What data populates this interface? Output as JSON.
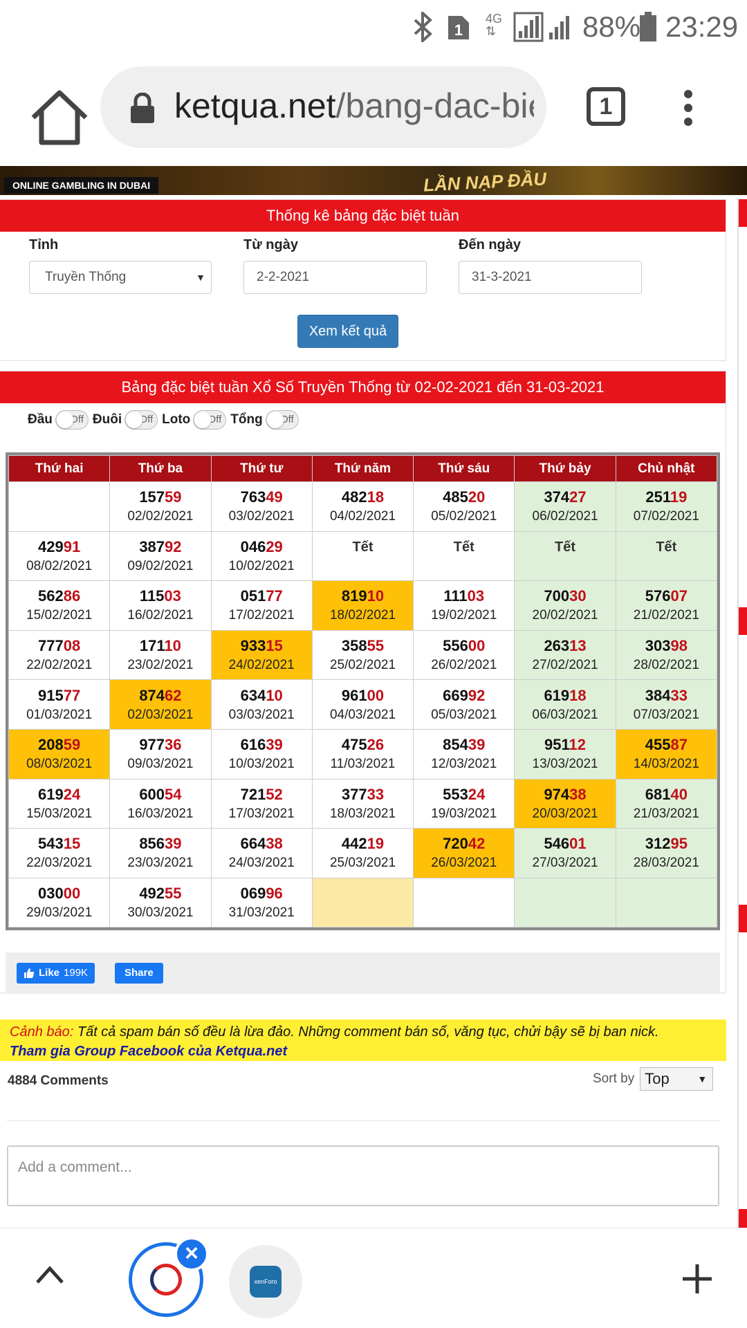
{
  "status_bar": {
    "battery": "88%",
    "time": "23:29",
    "network": "4G",
    "sim_badge": "1"
  },
  "browser": {
    "url_domain": "ketqua.net",
    "url_path": "/bang-dac-biet-tuan.html",
    "tab_count": "1"
  },
  "banner": {
    "left_text": "ONLINE GAMBLING IN DUBAI",
    "right_text": "LẦN NẠP ĐẦU"
  },
  "search_panel": {
    "title": "Thống kê bảng đặc biệt tuần",
    "province_label": "Tỉnh",
    "province_value": "Truyền Thống",
    "from_label": "Từ ngày",
    "from_value": "2-2-2021",
    "to_label": "Đến ngày",
    "to_value": "31-3-2021",
    "submit_label": "Xem kết quả"
  },
  "result_panel": {
    "title": "Bảng đặc biệt tuần Xổ Số Truyền Thống từ 02-02-2021 đến 31-03-2021",
    "toggles": [
      {
        "label": "Đầu",
        "state": "Off"
      },
      {
        "label": "Đuôi",
        "state": "Off"
      },
      {
        "label": "Loto",
        "state": "Off"
      },
      {
        "label": "Tổng",
        "state": "Off"
      }
    ]
  },
  "table": {
    "headers": [
      "Thứ hai",
      "Thứ ba",
      "Thứ tư",
      "Thứ năm",
      "Thứ sáu",
      "Thứ bảy",
      "Chủ nhật"
    ],
    "rows": [
      [
        {
          "empty": true
        },
        {
          "h": "157",
          "t": "59",
          "d": "02/02/2021"
        },
        {
          "h": "763",
          "t": "49",
          "d": "03/02/2021"
        },
        {
          "h": "482",
          "t": "18",
          "d": "04/02/2021"
        },
        {
          "h": "485",
          "t": "20",
          "d": "05/02/2021"
        },
        {
          "h": "374",
          "t": "27",
          "d": "06/02/2021"
        },
        {
          "h": "251",
          "t": "19",
          "d": "07/02/2021"
        }
      ],
      [
        {
          "h": "429",
          "t": "91",
          "d": "08/02/2021"
        },
        {
          "h": "387",
          "t": "92",
          "d": "09/02/2021"
        },
        {
          "h": "046",
          "t": "29",
          "d": "10/02/2021"
        },
        {
          "tet": "Tết"
        },
        {
          "tet": "Tết"
        },
        {
          "tet": "Tết"
        },
        {
          "tet": "Tết"
        }
      ],
      [
        {
          "h": "562",
          "t": "86",
          "d": "15/02/2021"
        },
        {
          "h": "115",
          "t": "03",
          "d": "16/02/2021"
        },
        {
          "h": "051",
          "t": "77",
          "d": "17/02/2021"
        },
        {
          "h": "819",
          "t": "10",
          "d": "18/02/2021",
          "hl": true
        },
        {
          "h": "111",
          "t": "03",
          "d": "19/02/2021"
        },
        {
          "h": "700",
          "t": "30",
          "d": "20/02/2021"
        },
        {
          "h": "576",
          "t": "07",
          "d": "21/02/2021"
        }
      ],
      [
        {
          "h": "777",
          "t": "08",
          "d": "22/02/2021"
        },
        {
          "h": "171",
          "t": "10",
          "d": "23/02/2021"
        },
        {
          "h": "933",
          "t": "15",
          "d": "24/02/2021",
          "hl": true
        },
        {
          "h": "358",
          "t": "55",
          "d": "25/02/2021"
        },
        {
          "h": "556",
          "t": "00",
          "d": "26/02/2021"
        },
        {
          "h": "263",
          "t": "13",
          "d": "27/02/2021"
        },
        {
          "h": "303",
          "t": "98",
          "d": "28/02/2021"
        }
      ],
      [
        {
          "h": "915",
          "t": "77",
          "d": "01/03/2021"
        },
        {
          "h": "874",
          "t": "62",
          "d": "02/03/2021",
          "hl": true
        },
        {
          "h": "634",
          "t": "10",
          "d": "03/03/2021"
        },
        {
          "h": "961",
          "t": "00",
          "d": "04/03/2021"
        },
        {
          "h": "669",
          "t": "92",
          "d": "05/03/2021"
        },
        {
          "h": "619",
          "t": "18",
          "d": "06/03/2021"
        },
        {
          "h": "384",
          "t": "33",
          "d": "07/03/2021"
        }
      ],
      [
        {
          "h": "208",
          "t": "59",
          "d": "08/03/2021",
          "hl": true
        },
        {
          "h": "977",
          "t": "36",
          "d": "09/03/2021"
        },
        {
          "h": "616",
          "t": "39",
          "d": "10/03/2021"
        },
        {
          "h": "475",
          "t": "26",
          "d": "11/03/2021"
        },
        {
          "h": "854",
          "t": "39",
          "d": "12/03/2021"
        },
        {
          "h": "951",
          "t": "12",
          "d": "13/03/2021"
        },
        {
          "h": "455",
          "t": "87",
          "d": "14/03/2021",
          "hl": true
        }
      ],
      [
        {
          "h": "619",
          "t": "24",
          "d": "15/03/2021"
        },
        {
          "h": "600",
          "t": "54",
          "d": "16/03/2021"
        },
        {
          "h": "721",
          "t": "52",
          "d": "17/03/2021"
        },
        {
          "h": "377",
          "t": "33",
          "d": "18/03/2021"
        },
        {
          "h": "553",
          "t": "24",
          "d": "19/03/2021"
        },
        {
          "h": "974",
          "t": "38",
          "d": "20/03/2021",
          "hl": true
        },
        {
          "h": "681",
          "t": "40",
          "d": "21/03/2021"
        }
      ],
      [
        {
          "h": "543",
          "t": "15",
          "d": "22/03/2021"
        },
        {
          "h": "856",
          "t": "39",
          "d": "23/03/2021"
        },
        {
          "h": "664",
          "t": "38",
          "d": "24/03/2021"
        },
        {
          "h": "442",
          "t": "19",
          "d": "25/03/2021"
        },
        {
          "h": "720",
          "t": "42",
          "d": "26/03/2021",
          "hl": true
        },
        {
          "h": "546",
          "t": "01",
          "d": "27/03/2021"
        },
        {
          "h": "312",
          "t": "95",
          "d": "28/03/2021"
        }
      ],
      [
        {
          "h": "030",
          "t": "00",
          "d": "29/03/2021"
        },
        {
          "h": "492",
          "t": "55",
          "d": "30/03/2021"
        },
        {
          "h": "069",
          "t": "96",
          "d": "31/03/2021"
        },
        {
          "empty": true,
          "pale": true
        },
        {
          "empty": true
        },
        {
          "empty": true
        },
        {
          "empty": true
        }
      ]
    ]
  },
  "facebook": {
    "like_label": "Like",
    "like_count": "199K",
    "share_label": "Share"
  },
  "warning": {
    "label": "Cảnh báo:",
    "text": " Tất cả spam bán số đều là lừa đảo. Những comment bán số, văng tục, chửi bậy sẽ bị ban nick.",
    "link": "Tham gia Group Facebook của Ketqua.net"
  },
  "comments": {
    "count_label": "4884 Comments",
    "sort_label": "Sort by",
    "sort_value": "Top",
    "placeholder": "Add a comment..."
  },
  "colors": {
    "red_header": "#e8141c",
    "table_header": "#a90f15",
    "highlight": "#ffc107",
    "weekend": "#dff0d8",
    "accent_blue": "#1a73e8"
  }
}
